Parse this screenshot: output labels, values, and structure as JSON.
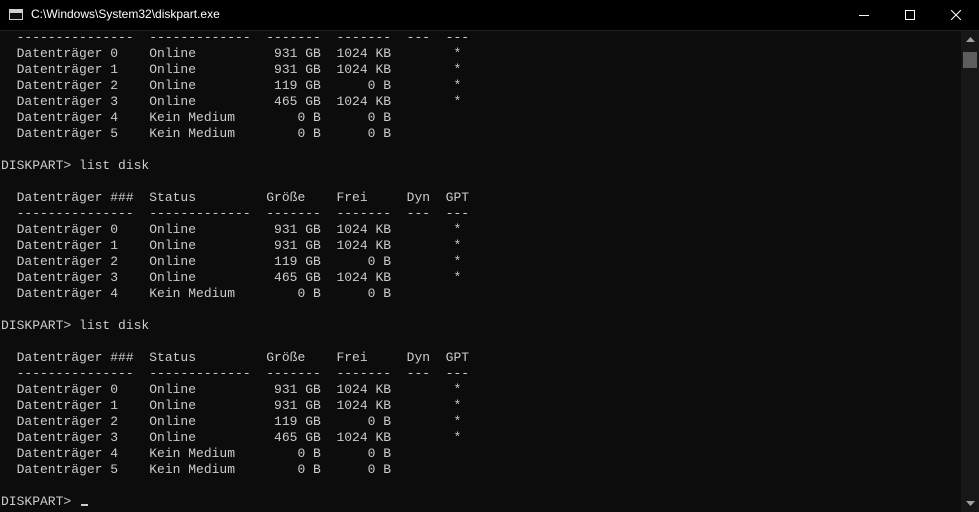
{
  "window": {
    "title": "C:\\Windows\\System32\\diskpart.exe"
  },
  "console": {
    "lines": [
      "  ---------------  -------------  -------  -------  ---  ---",
      "  Datenträger 0    Online          931 GB  1024 KB        *",
      "  Datenträger 1    Online          931 GB  1024 KB        *",
      "  Datenträger 2    Online          119 GB      0 B        *",
      "  Datenträger 3    Online          465 GB  1024 KB        *",
      "  Datenträger 4    Kein Medium        0 B      0 B",
      "  Datenträger 5    Kein Medium        0 B      0 B",
      "",
      "DISKPART> list disk",
      "",
      "  Datenträger ###  Status         Größe    Frei     Dyn  GPT",
      "  ---------------  -------------  -------  -------  ---  ---",
      "  Datenträger 0    Online          931 GB  1024 KB        *",
      "  Datenträger 1    Online          931 GB  1024 KB        *",
      "  Datenträger 2    Online          119 GB      0 B        *",
      "  Datenträger 3    Online          465 GB  1024 KB        *",
      "  Datenträger 4    Kein Medium        0 B      0 B",
      "",
      "DISKPART> list disk",
      "",
      "  Datenträger ###  Status         Größe    Frei     Dyn  GPT",
      "  ---------------  -------------  -------  -------  ---  ---",
      "  Datenträger 0    Online          931 GB  1024 KB        *",
      "  Datenträger 1    Online          931 GB  1024 KB        *",
      "  Datenträger 2    Online          119 GB      0 B        *",
      "  Datenträger 3    Online          465 GB  1024 KB        *",
      "  Datenträger 4    Kein Medium        0 B      0 B",
      "  Datenträger 5    Kein Medium        0 B      0 B",
      "",
      "DISKPART> "
    ]
  },
  "icons": {
    "app": "console-app-icon",
    "minimize": "minimize-icon",
    "maximize": "maximize-icon",
    "close": "close-icon",
    "scroll_up": "scroll-up-arrow-icon",
    "scroll_down": "scroll-down-arrow-icon"
  },
  "colors": {
    "background": "#0c0c0c",
    "text": "#cccccc",
    "titlebar": "#000000"
  }
}
